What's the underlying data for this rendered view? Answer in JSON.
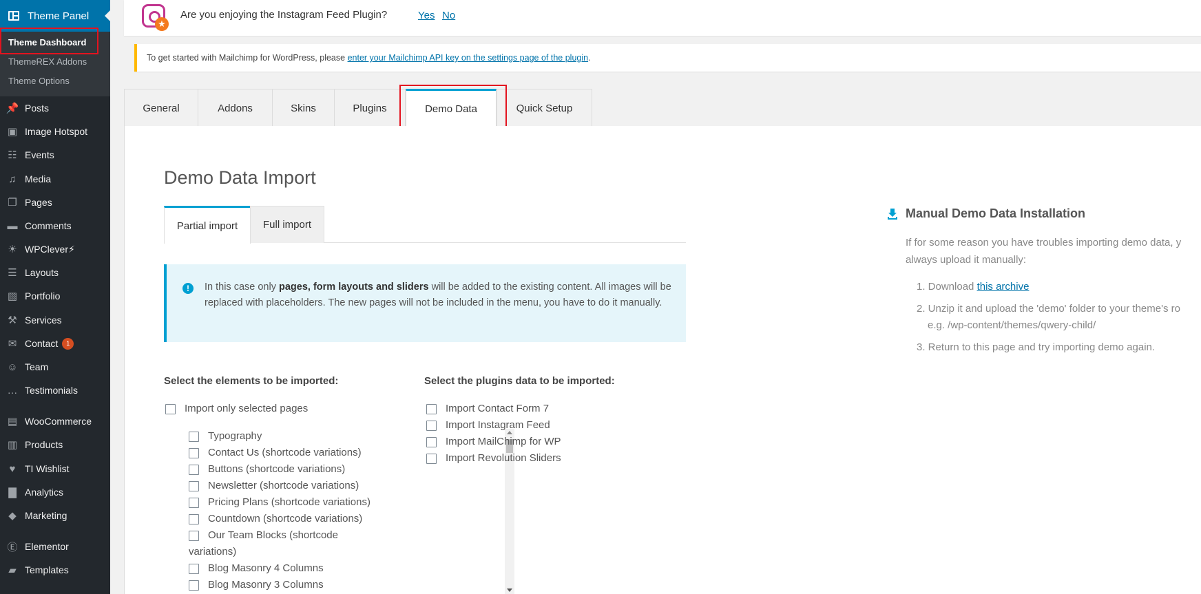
{
  "sidebar": {
    "header": "Theme Panel",
    "submenu": [
      "Theme Dashboard",
      "ThemeREX Addons",
      "Theme Options"
    ],
    "items": [
      {
        "label": "Posts",
        "icon": "pin-icon"
      },
      {
        "label": "Image Hotspot",
        "icon": "hotspot-icon"
      },
      {
        "label": "Events",
        "icon": "events-icon"
      },
      {
        "label": "Media",
        "icon": "media-icon"
      },
      {
        "label": "Pages",
        "icon": "pages-icon"
      },
      {
        "label": "Comments",
        "icon": "comments-icon"
      },
      {
        "label": "WPClever⚡",
        "icon": "wpclever-icon"
      },
      {
        "label": "Layouts",
        "icon": "layouts-icon"
      },
      {
        "label": "Portfolio",
        "icon": "portfolio-icon"
      },
      {
        "label": "Services",
        "icon": "services-icon"
      },
      {
        "label": "Contact",
        "icon": "mail-icon",
        "badge": "1"
      },
      {
        "label": "Team",
        "icon": "team-icon"
      },
      {
        "label": "Testimonials",
        "icon": "testimonials-icon"
      },
      {
        "label": "WooCommerce",
        "icon": "woo-icon"
      },
      {
        "label": "Products",
        "icon": "products-icon"
      },
      {
        "label": "TI Wishlist",
        "icon": "wishlist-icon"
      },
      {
        "label": "Analytics",
        "icon": "analytics-icon"
      },
      {
        "label": "Marketing",
        "icon": "marketing-icon"
      },
      {
        "label": "Elementor",
        "icon": "elementor-icon"
      },
      {
        "label": "Templates",
        "icon": "templates-icon"
      }
    ]
  },
  "notice_instagram": {
    "question": "Are you enjoying the Instagram Feed Plugin?",
    "yes": "Yes",
    "no": "No"
  },
  "notice_mailchimp": {
    "text": "To get started with Mailchimp for WordPress, please ",
    "link": "enter your Mailchimp API key on the settings page of the plugin",
    "end": "."
  },
  "tabs": [
    "General",
    "Addons",
    "Skins",
    "Plugins",
    "Demo Data",
    "Quick Setup"
  ],
  "active_tab": "Demo Data",
  "demo": {
    "title": "Demo Data Import",
    "subtabs": [
      "Partial import",
      "Full import"
    ],
    "info_prefix": "In this case only ",
    "info_bold": "pages, form layouts and sliders",
    "info_suffix": " will be added to the existing content. All images will be replaced with placeholders. The new pages will not be included in the menu, you have to do it manually.",
    "elements_heading": "Select the elements to be imported:",
    "only_selected": "Import only selected pages",
    "pages": [
      "Typography",
      "Contact Us (shortcode variations)",
      "Buttons (shortcode variations)",
      "Newsletter (shortcode variations)",
      "Pricing Plans (shortcode variations)",
      "Countdown (shortcode variations)",
      "Our Team Blocks (shortcode",
      "variations)",
      "Blog Masonry 4 Columns",
      "Blog Masonry 3 Columns"
    ],
    "plugins_heading": "Select the plugins data to be imported:",
    "plugins": [
      "Import Contact Form 7",
      "Import Instagram Feed",
      "Import MailChimp for WP",
      "Import Revolution Sliders"
    ]
  },
  "manual": {
    "title": "Manual Demo Data Installation",
    "intro_1": "If for some reason you have troubles importing demo data, y",
    "intro_2": "always upload it manually:",
    "step1_prefix": "1. Download ",
    "step1_link": "this archive",
    "step2_a": "2. Unzip it and upload the 'demo' folder to your theme's ro",
    "step2_b": "e.g. /wp-content/themes/qwery-child/",
    "step3": "3. Return to this page and try importing demo again."
  }
}
